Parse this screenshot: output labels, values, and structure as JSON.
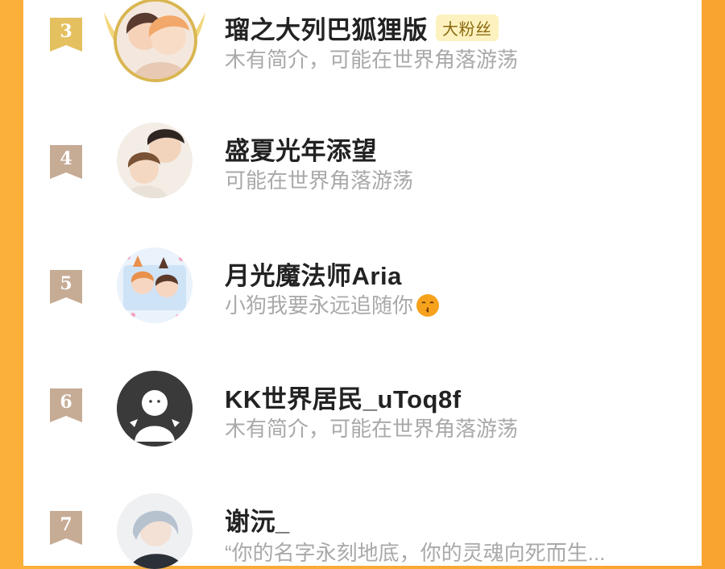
{
  "colors": {
    "background_orange": "#fbb03b",
    "rank_gold": "#e4c05f",
    "rank_muted": "#c6ab95",
    "fan_badge_bg": "#fdf2bf",
    "name_text": "#222222",
    "bio_text": "#a9a9a9"
  },
  "fans": [
    {
      "rank": "3",
      "name": "瑠之大列巴狐狸版",
      "badge": "大粉丝",
      "bio": "木有简介，可能在世界角落游荡",
      "avatar_icon": "anime-couple-avatar-gold-frame"
    },
    {
      "rank": "4",
      "name": "盛夏光年添望",
      "bio": "可能在世界角落游荡",
      "avatar_icon": "anime-boys-avatar"
    },
    {
      "rank": "5",
      "name": "月光魔法师Aria",
      "bio": "小狗我要永远追随你",
      "bio_emoji": "kissing-face-emoji",
      "avatar_icon": "anime-fox-ears-avatar"
    },
    {
      "rank": "6",
      "name": "KK世界居民_uToq8f",
      "bio": "木有简介，可能在世界角落游荡",
      "avatar_icon": "default-user-avatar"
    },
    {
      "rank": "7",
      "name": "谢沅_",
      "bio": "“你的名字永刻地底，你的灵魂向死而生...",
      "avatar_icon": "anime-silver-hair-avatar"
    }
  ]
}
